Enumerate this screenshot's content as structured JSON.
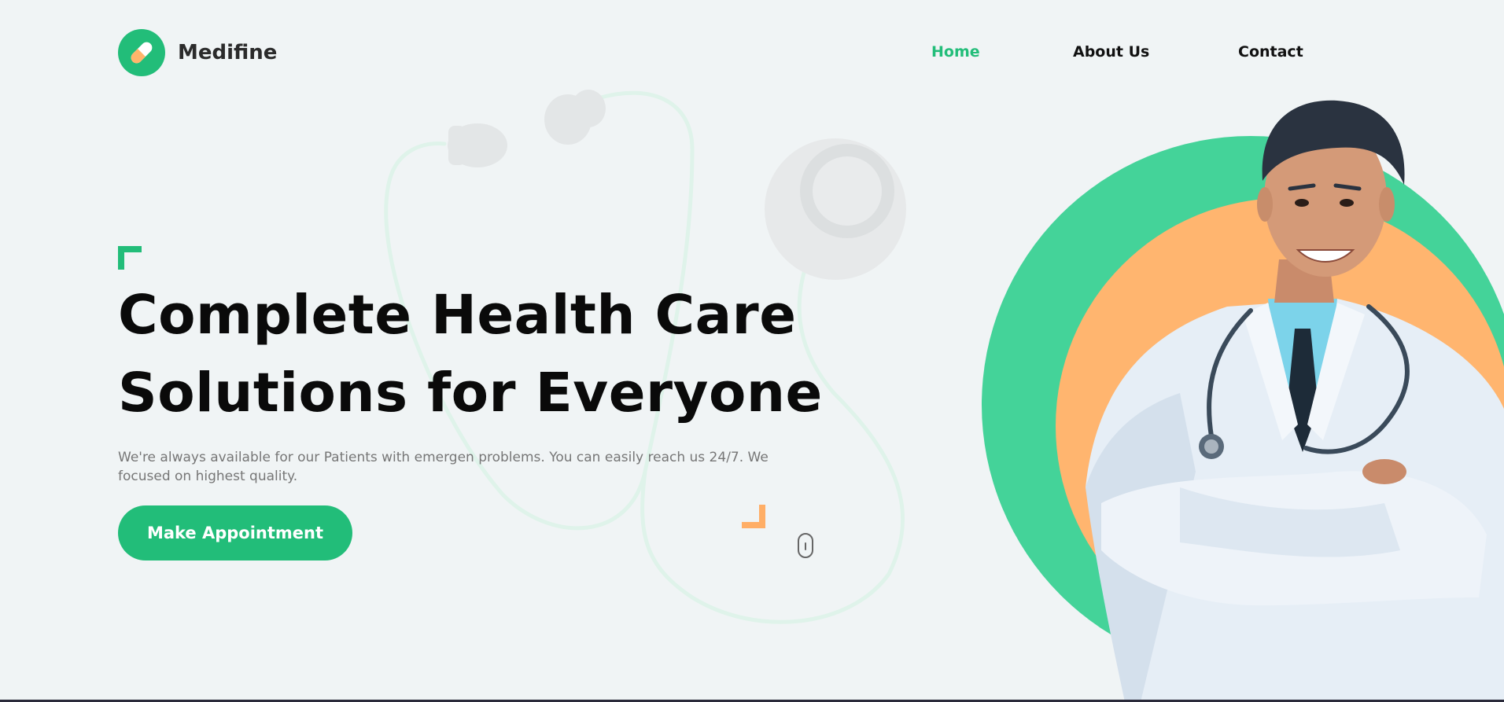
{
  "brand": {
    "name": "Medifine",
    "icon": "pill-icon"
  },
  "nav": {
    "items": [
      {
        "label": "Home",
        "active": true
      },
      {
        "label": "About Us",
        "active": false
      },
      {
        "label": "Contact",
        "active": false
      }
    ]
  },
  "hero": {
    "title_line1": "Complete Health Care",
    "title_line2": "Solutions for Everyone",
    "description": "We're always available for our Patients with emergen problems. You can easily reach us 24/7. We focused on highest quality.",
    "cta_label": "Make Appointment",
    "image": "doctor-photo",
    "scroll_icon": "mouse-scroll-icon",
    "background_icon": "stethoscope-icon"
  },
  "colors": {
    "brand_green": "#22bd79",
    "accent_orange": "#ffae66",
    "circle_green": "#44d399",
    "background": "#f0f4f5"
  }
}
